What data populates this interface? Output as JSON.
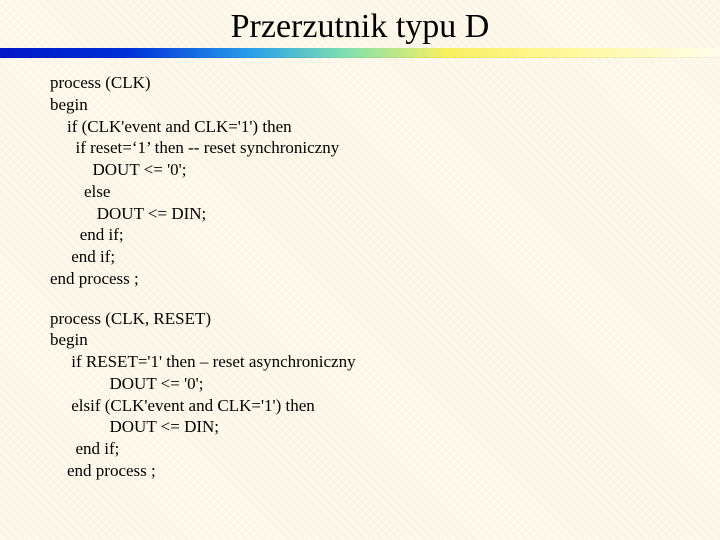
{
  "title": "Przerzutnik typu D",
  "code1": "process (CLK)\nbegin\n    if (CLK'event and CLK='1') then\n      if reset=‘1’ then -- reset synchroniczny\n          DOUT <= '0';\n        else\n           DOUT <= DIN;\n       end if;\n     end if;\nend process ;",
  "code2": "process (CLK, RESET)\nbegin\n     if RESET='1' then – reset asynchroniczny\n              DOUT <= '0';\n     elsif (CLK'event and CLK='1') then\n              DOUT <= DIN;\n      end if;\n    end process ;"
}
